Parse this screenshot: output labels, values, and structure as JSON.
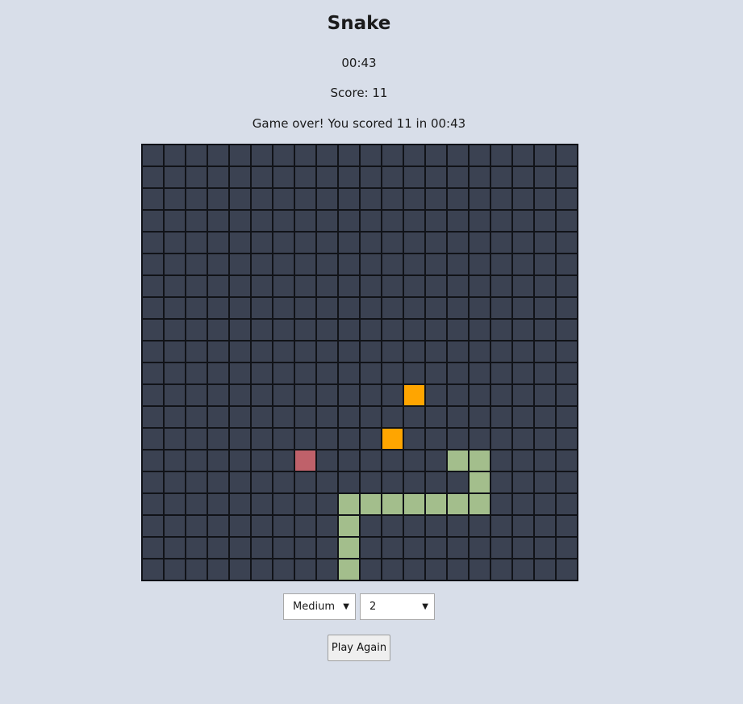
{
  "game": {
    "title": "Snake",
    "timer": "00:43",
    "score_text": "Score: 11",
    "message": "Game over! You scored 11 in 00:43"
  },
  "board": {
    "cols": 20,
    "rows": 20,
    "snake": [
      [
        9,
        19
      ],
      [
        9,
        18
      ],
      [
        9,
        17
      ],
      [
        9,
        16
      ],
      [
        10,
        16
      ],
      [
        11,
        16
      ],
      [
        12,
        16
      ],
      [
        13,
        16
      ],
      [
        14,
        16
      ],
      [
        15,
        16
      ],
      [
        15,
        15
      ],
      [
        15,
        14
      ],
      [
        14,
        14
      ]
    ],
    "food": [
      [
        12,
        11
      ],
      [
        11,
        13
      ]
    ],
    "head": [
      [
        7,
        14
      ]
    ],
    "colors": {
      "empty": "#3b4252",
      "snake": "#a3be8c",
      "food": "#ffa500",
      "head": "#bf616a"
    }
  },
  "controls": {
    "difficulty": "Medium",
    "size": "2",
    "play_again": "Play Again"
  },
  "icons": {
    "caret": "▼"
  }
}
